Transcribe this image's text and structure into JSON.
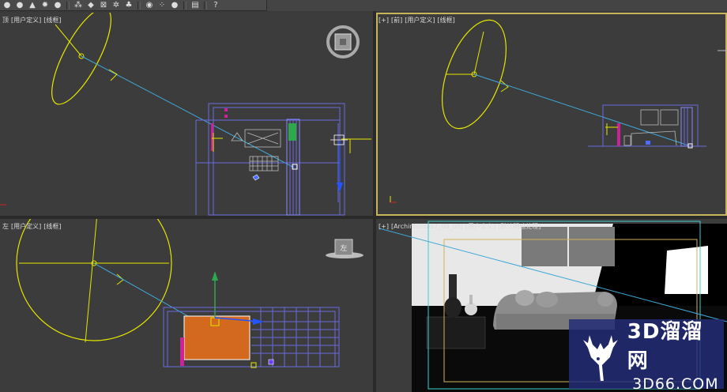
{
  "toolbar": {
    "buttons": [
      {
        "name": "omni-light-icon",
        "glyph": "●"
      },
      {
        "name": "omni-light-2-icon",
        "glyph": "●"
      },
      {
        "name": "spot-light-icon",
        "glyph": "▲"
      },
      {
        "name": "sun-light-icon",
        "glyph": "✹"
      },
      {
        "name": "skylight-icon",
        "glyph": "●"
      },
      {
        "name": "particle-icon",
        "glyph": "⁂"
      },
      {
        "name": "camera-target-icon",
        "glyph": "◆"
      },
      {
        "name": "bounding-box-icon",
        "glyph": "⊠"
      },
      {
        "name": "settings-gear-icon",
        "glyph": "✲"
      },
      {
        "name": "plant-icon",
        "glyph": "♣"
      },
      {
        "name": "sphere-icon",
        "glyph": "◉"
      },
      {
        "name": "primitives-icon",
        "glyph": "⁘"
      },
      {
        "name": "material-icon",
        "glyph": "●"
      },
      {
        "name": "render-frame-icon",
        "glyph": "▤"
      },
      {
        "name": "help-icon",
        "glyph": "?"
      }
    ]
  },
  "viewports": {
    "top_left": {
      "label": [
        "顶",
        "[用户定义]",
        "[线框]"
      ]
    },
    "top_right": {
      "label": [
        "[+]",
        "[前]",
        "[用户定义]",
        "[线框]"
      ]
    },
    "bottom_left": {
      "label": [
        "左",
        "[用户定义]",
        "[线框]"
      ]
    },
    "bottom_right": {
      "label": [
        "[+]",
        "[Archinteriors7_08_08]",
        "[用户定义]",
        "[默认明暗处理]"
      ]
    }
  },
  "viewcube": {
    "face_label": "左"
  },
  "watermark": {
    "title": "3D溜溜网",
    "subtitle": "3D66.COM"
  },
  "colors": {
    "viewport_bg": "#3c3c3c",
    "active_border": "#c8b45a",
    "light_gizmo": "#e6e600",
    "light_ray": "#3fa7d6",
    "wireframe": "#6a6ae0",
    "selected_object": "#d2691e",
    "watermark_bg": "#232d78"
  }
}
